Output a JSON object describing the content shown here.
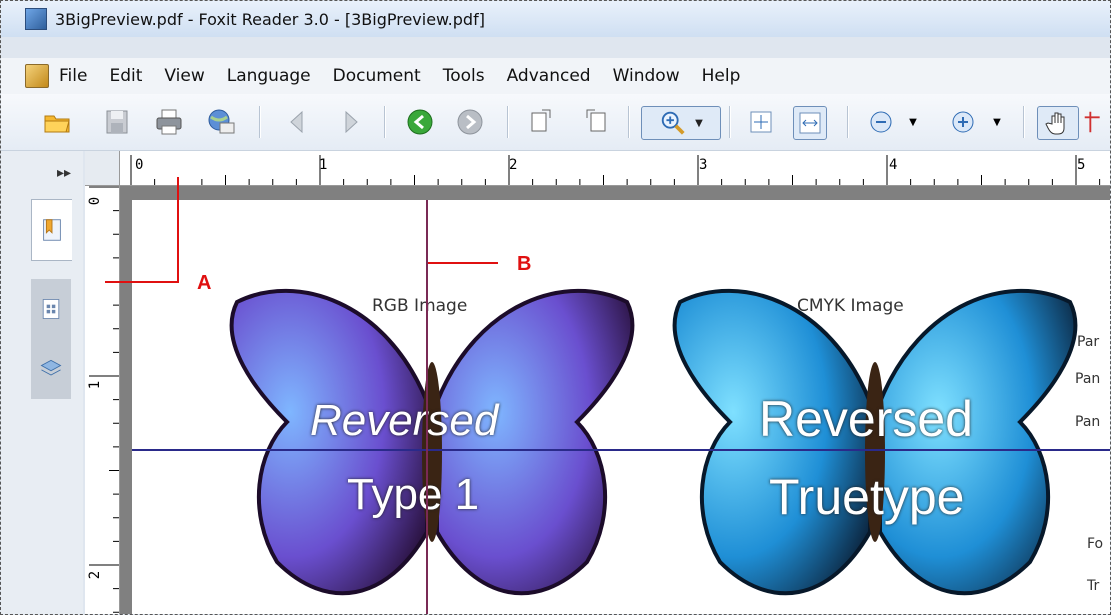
{
  "window": {
    "title": "3BigPreview.pdf - Foxit Reader 3.0 - [3BigPreview.pdf]"
  },
  "menu": [
    "File",
    "Edit",
    "View",
    "Language",
    "Document",
    "Tools",
    "Advanced",
    "Window",
    "Help"
  ],
  "toolbar_icons": [
    "open-folder-icon",
    "save-icon",
    "print-icon",
    "email-icon",
    "previous-page-icon",
    "next-page-icon",
    "go-back-icon",
    "go-forward-icon",
    "rotate-left-icon",
    "rotate-right-icon",
    "zoom-in-tool-icon",
    "fit-page-icon",
    "fit-width-icon",
    "zoom-out-icon",
    "zoom-plus-icon",
    "hand-tool-icon"
  ],
  "rulers": {
    "top": [
      "0",
      "1",
      "2",
      "3",
      "4",
      "5"
    ],
    "left": [
      "0",
      "1",
      "2"
    ]
  },
  "page": {
    "rgb_caption": "RGB Image",
    "cmyk_caption": "CMYK Image",
    "rgb_line1": "Reversed",
    "rgb_line2": "Type 1",
    "cmyk_line1": "Reversed",
    "cmyk_line2": "Truetype",
    "side_texts": [
      "Par",
      "Pan",
      "Pan",
      "Fo",
      "Tr"
    ]
  },
  "annotations": {
    "a": "A",
    "b": "B"
  },
  "colors": {
    "accent_red": "#e01010",
    "guide_h": "#2a2a8a",
    "guide_v": "#7a2a55"
  }
}
